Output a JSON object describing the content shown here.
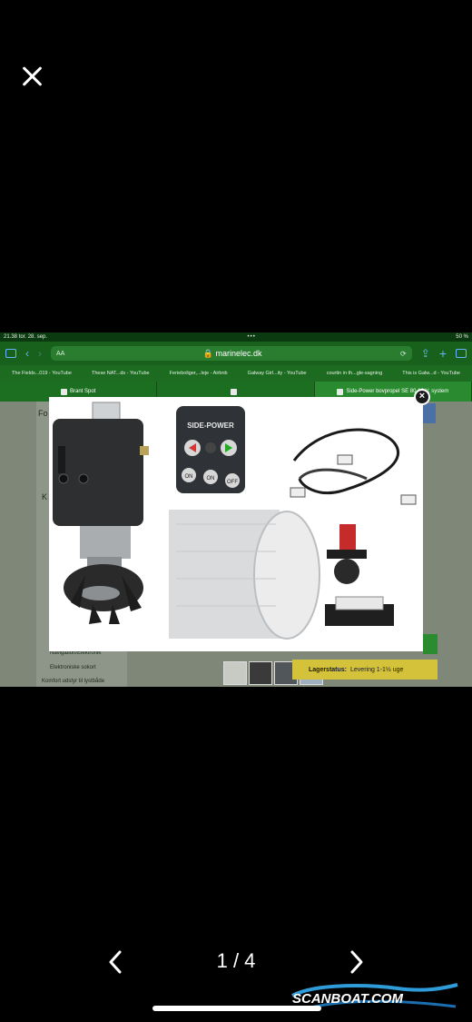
{
  "viewer": {
    "counter": "1 / 4",
    "brand": "SCANBOAT.COM"
  },
  "screenshot": {
    "status": {
      "time": "21.38",
      "date": "tor. 28. sep.",
      "battery": "50 %"
    },
    "url": {
      "aa": "AA",
      "host": "marinelec.dk"
    },
    "bookmarks": [
      "The Fields...019 - YouTube",
      "These NAT...ds - YouTube",
      "Ferieboliger,...leje - Airbnb",
      "Galway Girl...ity - YouTube",
      "courtin in th...gle-sagning",
      "This is Galw...d - YouTube"
    ],
    "tabs": [
      {
        "label": "Brant Spot"
      },
      {
        "label": ""
      },
      {
        "label": "Side-Power bovpropel SE 80 12 V. system"
      }
    ],
    "sidebar_items": [
      "Fo",
      "K",
      "Navigation/Elektronik",
      "Elektroniske sokort",
      "Komfort udstyr til lystbåde"
    ],
    "status_box": {
      "label": "Lagerstatus:",
      "value": "Levering 1-1½ uge"
    }
  },
  "product": {
    "panel_brand": "SIDE-POWER",
    "buttons": [
      "ON",
      "ON",
      "OFF"
    ]
  }
}
